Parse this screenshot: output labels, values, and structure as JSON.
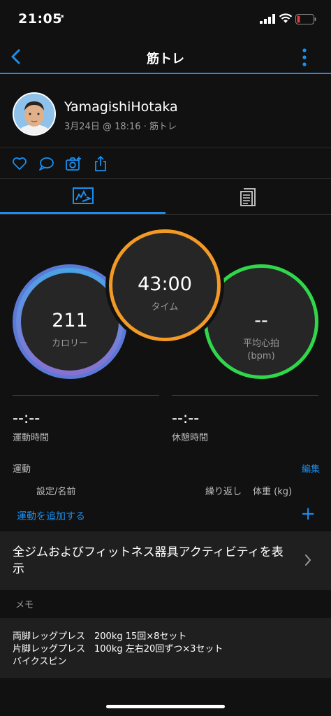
{
  "status_bar": {
    "time": "21:05",
    "location_glyph": "➚"
  },
  "nav": {
    "title": "筋トレ",
    "back_icon": "chevron-left",
    "more_icon": "vertical-dots"
  },
  "profile": {
    "name": "YamagishiHotaka",
    "meta": "3月24日 @ 18:16 · 筋トレ"
  },
  "actions": [
    "like-icon",
    "comment-icon",
    "camera-icon",
    "share-icon"
  ],
  "tabs": [
    {
      "name": "summary",
      "icon": "chart-icon",
      "selected": true
    },
    {
      "name": "details",
      "icon": "document-icon",
      "selected": false
    }
  ],
  "rings": {
    "calories": {
      "value": "211",
      "label": "カロリー"
    },
    "time": {
      "value": "43:00",
      "label": "タイム"
    },
    "heart_rate": {
      "value": "--",
      "label_line1": "平均心拍",
      "label_line2": "(bpm)"
    }
  },
  "stats": {
    "workout_time": {
      "value": "--:--",
      "label": "運動時間"
    },
    "rest_time": {
      "value": "--:--",
      "label": "休憩時間"
    }
  },
  "exercise": {
    "heading": "運動",
    "edit": "編集",
    "col_set": "設定/名前",
    "col_reps": "繰り返し",
    "col_weight": "体重 (kg)",
    "add": "運動を追加する",
    "plus": "+"
  },
  "view_all": {
    "text": "全ジムおよびフィットネス器具アクティビティを表示"
  },
  "memo": {
    "heading": "メモ",
    "line1": "両脚レッグプレス　200kg 15回×8セット",
    "line2": "片脚レッグプレス　100kg 左右20回ずつ×3セット",
    "line3": "バイクスピン"
  },
  "colors": {
    "accent": "#1a8ff0",
    "calories": "#5b79d6",
    "time": "#f39a26",
    "heart_rate": "#2fd84a"
  }
}
